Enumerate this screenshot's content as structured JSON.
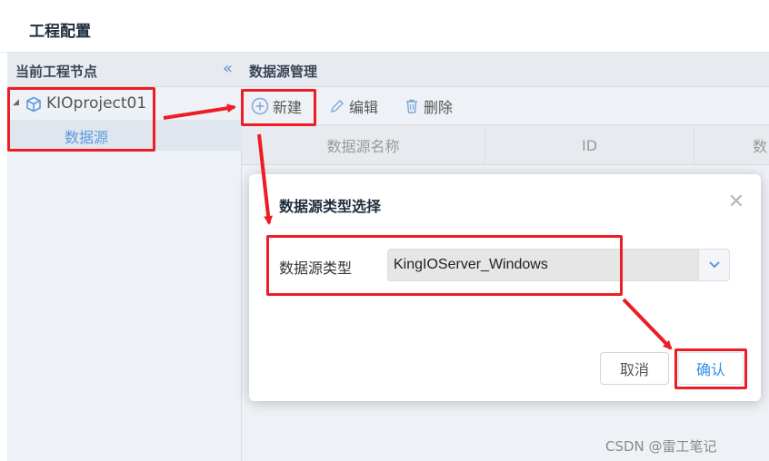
{
  "page": {
    "title": "工程配置"
  },
  "left_panel": {
    "header": "当前工程节点",
    "collapse_icon": "double-chevron-left-icon",
    "tree": {
      "project": {
        "name": "KIOproject01",
        "icon": "cube-icon"
      },
      "child": "数据源"
    }
  },
  "right_panel": {
    "header": "数据源管理",
    "toolbar": {
      "new": "新建",
      "edit": "编辑",
      "delete": "删除"
    },
    "columns": [
      "数据源名称",
      "ID",
      "数"
    ]
  },
  "dialog": {
    "title": "数据源类型选择",
    "field_label": "数据源类型",
    "selected_value": "KingIOServer_Windows",
    "cancel": "取消",
    "confirm": "确认"
  },
  "annotation_color": "#ee1c24",
  "watermark": "CSDN @雷工笔记"
}
